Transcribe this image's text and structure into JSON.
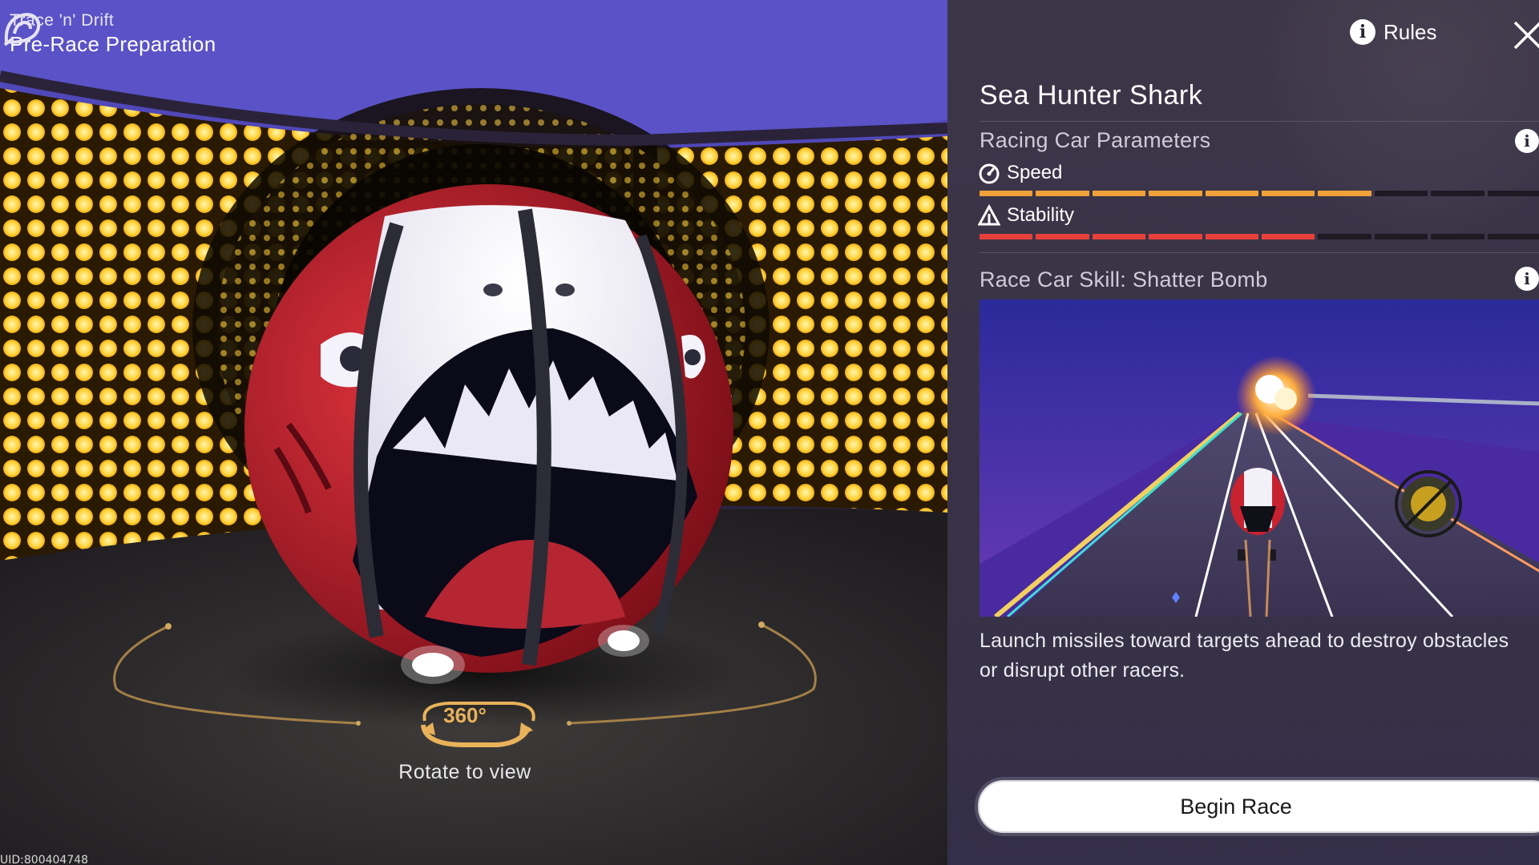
{
  "header": {
    "subtitle": "Trace 'n' Drift",
    "title": "Pre-Race Preparation",
    "icon": "drift-logo-icon"
  },
  "viewer": {
    "rotate_badge": "360°",
    "rotate_label": "Rotate to view",
    "uid": "UID:800404748"
  },
  "panel": {
    "rules_label": "Rules",
    "car_name": "Sea Hunter Shark",
    "params_title": "Racing Car Parameters",
    "stats": [
      {
        "label": "Speed",
        "icon": "speedometer-icon",
        "level": 0.7,
        "color": "#f0a13a"
      },
      {
        "label": "Stability",
        "icon": "stability-icon",
        "level": 0.6,
        "color": "#e8403a"
      }
    ],
    "skill_title": "Race Car Skill: Shatter Bomb",
    "skill_description": "Launch missiles toward targets ahead to destroy obstacles or disrupt other racers.",
    "begin_label": "Begin Race"
  },
  "colors": {
    "panel_bg": "#3a3347",
    "speed": "#f0a13a",
    "stability": "#e8403a",
    "bar_empty": "#1e1a24",
    "shark_red": "#c8212f"
  }
}
